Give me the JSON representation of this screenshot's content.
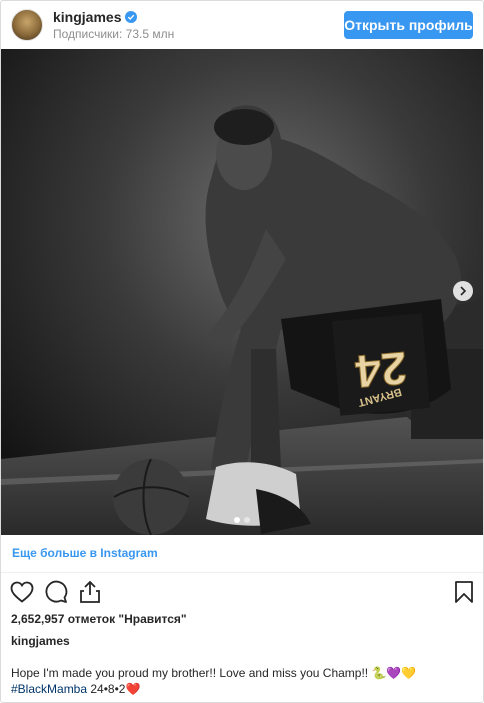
{
  "header": {
    "username": "kingjames",
    "followers": "Подписчики: 73.5 млн",
    "open_profile_label": "Открыть профиль"
  },
  "photo": {
    "jersey_number": "24",
    "jersey_name": "BRYANT",
    "carousel_dots": 2,
    "active_dot": 1
  },
  "more_link": "Еще больше в Instagram",
  "actions": {
    "icons": [
      "heart-icon",
      "comment-icon",
      "share-icon",
      "bookmark-icon"
    ]
  },
  "likes": "2,652,957 отметок \"Нравится\"",
  "caption": {
    "username": "kingjames",
    "text": "Hope I'm made you proud my brother!! Love and miss you Champ!! 🐍💜💛",
    "hashtag": "#BlackMamba",
    "suffix": " 24•8•2❤️"
  },
  "colors": {
    "accent": "#3897f0",
    "text": "#262626",
    "secondary": "#8e8e8e",
    "hashtag": "#003569"
  }
}
